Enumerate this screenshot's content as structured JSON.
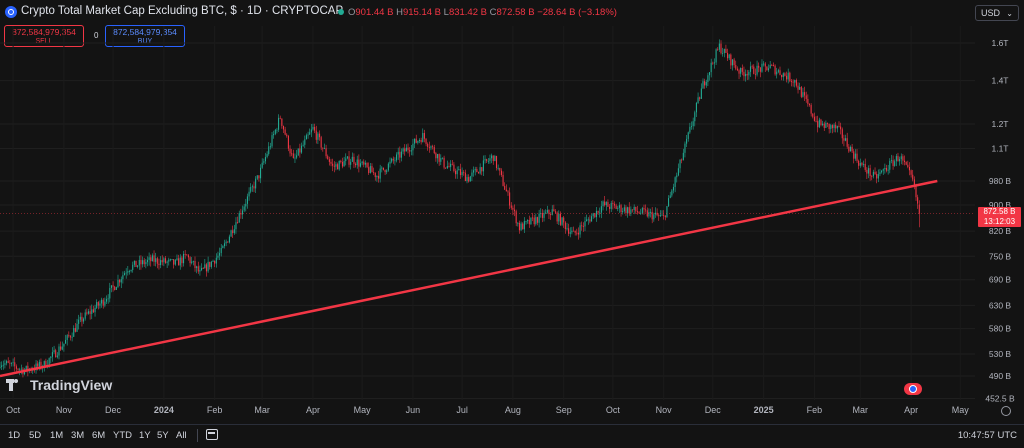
{
  "header": {
    "title": "Crypto Total Market Cap Excluding BTC, $ · 1D · CRYPTOCAP",
    "ohlc": [
      {
        "k": "O",
        "v": "901.44 B"
      },
      {
        "k": "H",
        "v": "915.14 B"
      },
      {
        "k": "L",
        "v": "831.42 B"
      },
      {
        "k": "C",
        "v": "872.58 B"
      }
    ],
    "change": "−28.64 B (−3.18%)",
    "currency": "USD",
    "icons": [
      "crypto-symbol-icon",
      "market-status-dot",
      "chevron-down-icon"
    ]
  },
  "trade": {
    "sell_price": "872,584,979,354",
    "sell_label": "SELL",
    "spread": "0",
    "buy_price": "872,584,979,354",
    "buy_label": "BUY"
  },
  "price_tag": {
    "value": "872.58 B",
    "countdown": "13:12:03"
  },
  "watermark": "TradingView",
  "footer": {
    "ranges": [
      "1D",
      "5D",
      "1M",
      "3M",
      "6M",
      "YTD",
      "1Y",
      "5Y",
      "All"
    ],
    "time": "10:47:57 UTC",
    "icons": [
      "calendar-icon",
      "settings-icon"
    ]
  },
  "colors": {
    "up": "#22ab94",
    "down": "#f23645",
    "trendline": "#f23645",
    "background": "#131313"
  },
  "chart_data": {
    "type": "candlestick",
    "title": "Crypto Total Market Cap Excluding BTC, $ · 1D · CRYPTOCAP",
    "y_scale": "log",
    "ylim": [
      450,
      1700
    ],
    "y_ticks": [
      {
        "value": 1600,
        "label": "1.6T"
      },
      {
        "value": 1400,
        "label": "1.4T"
      },
      {
        "value": 1200,
        "label": "1.2T"
      },
      {
        "value": 1100,
        "label": "1.1T"
      },
      {
        "value": 980,
        "label": "980 B"
      },
      {
        "value": 900,
        "label": "900 B"
      },
      {
        "value": 820,
        "label": "820 B"
      },
      {
        "value": 750,
        "label": "750 B"
      },
      {
        "value": 690,
        "label": "690 B"
      },
      {
        "value": 630,
        "label": "630 B"
      },
      {
        "value": 580,
        "label": "580 B"
      },
      {
        "value": 530,
        "label": "530 B"
      },
      {
        "value": 490,
        "label": "490 B"
      },
      {
        "value": 452.5,
        "label": "452.5 B"
      }
    ],
    "x_ticks": [
      "Oct",
      "Nov",
      "Dec",
      "2024",
      "Feb",
      "Mar",
      "Apr",
      "May",
      "Jun",
      "Jul",
      "Aug",
      "Sep",
      "Oct",
      "Nov",
      "Dec",
      "2025",
      "Feb",
      "Mar",
      "Apr",
      "May"
    ],
    "x_range": [
      "2023-09-23",
      "2025-05-10"
    ],
    "last_date": "2025-04-06",
    "close_path": [
      [
        "2023-09-23",
        515
      ],
      [
        "2023-10-08",
        500
      ],
      [
        "2023-10-20",
        510
      ],
      [
        "2023-11-01",
        550
      ],
      [
        "2023-11-12",
        600
      ],
      [
        "2023-11-25",
        640
      ],
      [
        "2023-12-10",
        720
      ],
      [
        "2023-12-25",
        740
      ],
      [
        "2024-01-08",
        730
      ],
      [
        "2024-01-15",
        750
      ],
      [
        "2024-01-23",
        705
      ],
      [
        "2024-02-05",
        760
      ],
      [
        "2024-02-15",
        860
      ],
      [
        "2024-02-28",
        1000
      ],
      [
        "2024-03-12",
        1230
      ],
      [
        "2024-03-20",
        1050
      ],
      [
        "2024-04-01",
        1180
      ],
      [
        "2024-04-13",
        1030
      ],
      [
        "2024-04-25",
        1060
      ],
      [
        "2024-05-10",
        1000
      ],
      [
        "2024-05-25",
        1080
      ],
      [
        "2024-06-07",
        1150
      ],
      [
        "2024-06-20",
        1040
      ],
      [
        "2024-07-05",
        990
      ],
      [
        "2024-07-20",
        1070
      ],
      [
        "2024-08-05",
        830
      ],
      [
        "2024-08-25",
        880
      ],
      [
        "2024-09-07",
        810
      ],
      [
        "2024-09-25",
        900
      ],
      [
        "2024-10-15",
        880
      ],
      [
        "2024-11-01",
        860
      ],
      [
        "2024-11-12",
        1060
      ],
      [
        "2024-11-25",
        1380
      ],
      [
        "2024-12-05",
        1580
      ],
      [
        "2024-12-18",
        1440
      ],
      [
        "2025-01-05",
        1470
      ],
      [
        "2025-01-20",
        1400
      ],
      [
        "2025-02-03",
        1200
      ],
      [
        "2025-02-15",
        1180
      ],
      [
        "2025-03-01",
        1040
      ],
      [
        "2025-03-10",
        990
      ],
      [
        "2025-03-25",
        1070
      ],
      [
        "2025-04-02",
        980
      ],
      [
        "2025-04-06",
        872.58
      ]
    ],
    "ohlc_last": {
      "open": 901.44,
      "high": 915.14,
      "low": 831.42,
      "close": 872.58
    },
    "trendline": {
      "color": "#f23645",
      "points": [
        [
          "2023-09-23",
          490
        ],
        [
          "2025-04-17",
          980
        ]
      ]
    },
    "current_price": 872.58
  }
}
